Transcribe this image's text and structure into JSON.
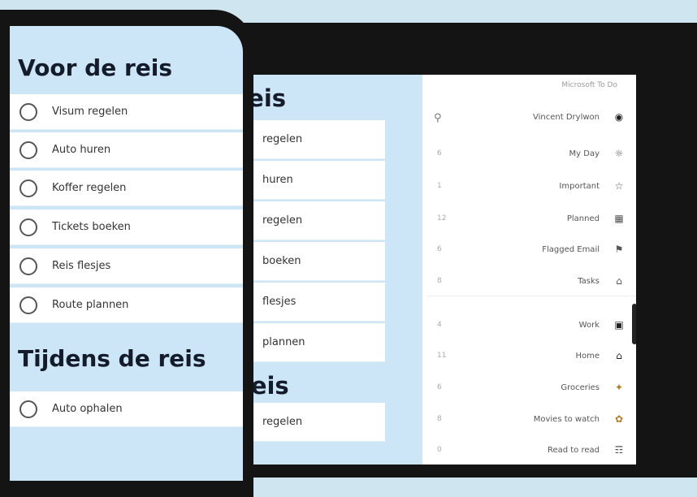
{
  "phone": {
    "section1_title": "Voor de reis",
    "section2_title": "Tijdens de reis",
    "items": [
      {
        "label": "Visum regelen"
      },
      {
        "label": "Auto huren"
      },
      {
        "label": "Koffer regelen"
      },
      {
        "label": "Tickets boeken"
      },
      {
        "label": "Reis flesjes"
      },
      {
        "label": "Route plannen"
      }
    ],
    "section2_items": [
      {
        "label": "Auto ophalen"
      }
    ]
  },
  "tablet": {
    "section1_title": "or de reis",
    "section2_title": "ns de reis",
    "items": [
      {
        "label": "regelen"
      },
      {
        "label": "huren"
      },
      {
        "label": "regelen"
      },
      {
        "label": "boeken"
      },
      {
        "label": "flesjes"
      },
      {
        "label": "plannen"
      }
    ],
    "section2_items": [
      {
        "label": "regelen"
      }
    ],
    "sidebar": {
      "header": "Microsoft To Do",
      "search_icon": "search-icon",
      "items": [
        {
          "label": "Vincent Drylwon",
          "count": "",
          "icon": "avatar"
        },
        {
          "label": "My Day",
          "count": "6",
          "icon": "sun-icon"
        },
        {
          "label": "Important",
          "count": "1",
          "icon": "star-icon"
        },
        {
          "label": "Planned",
          "count": "12",
          "icon": "calendar-icon"
        },
        {
          "label": "Flagged Email",
          "count": "6",
          "icon": "flag-icon"
        },
        {
          "label": "Tasks",
          "count": "8",
          "icon": "home-icon"
        },
        {
          "label": "Work",
          "count": "4",
          "icon": "briefcase-icon"
        },
        {
          "label": "Home",
          "count": "11",
          "icon": "house-icon"
        },
        {
          "label": "Groceries",
          "count": "6",
          "icon": "carrot-icon"
        },
        {
          "label": "Movies to watch",
          "count": "8",
          "icon": "popcorn-icon"
        },
        {
          "label": "Read to read",
          "count": "0",
          "icon": "book-icon"
        }
      ]
    }
  },
  "colors": {
    "background": "#cfe6f1",
    "list_panel": "#cde6f7",
    "device_frame": "#141414",
    "heading_text": "#141b2a"
  }
}
